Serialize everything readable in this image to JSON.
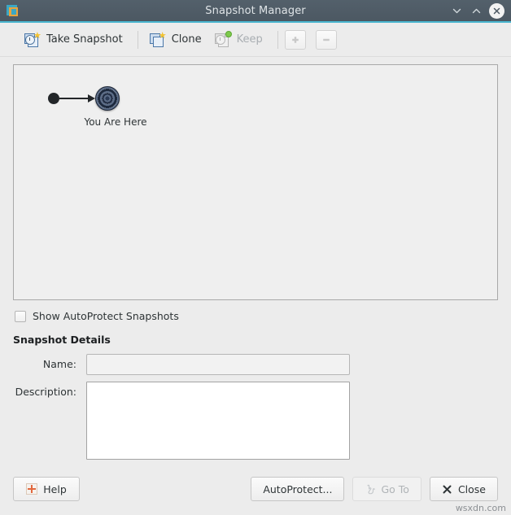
{
  "window": {
    "title": "Snapshot Manager",
    "app_icon": "vmware-logo-icon",
    "controls": {
      "minimize": "chevron-down-icon",
      "maximize": "chevron-up-icon",
      "close": "close-icon"
    }
  },
  "toolbar": {
    "take_snapshot": {
      "label": "Take Snapshot",
      "icon": "take-snapshot-icon",
      "enabled": true
    },
    "clone": {
      "label": "Clone",
      "icon": "clone-icon",
      "enabled": true
    },
    "keep": {
      "label": "Keep",
      "icon": "keep-icon",
      "enabled": false
    },
    "zoom_in": {
      "icon": "plus-icon",
      "enabled": false
    },
    "zoom_out": {
      "icon": "minus-icon",
      "enabled": false
    }
  },
  "canvas": {
    "node_caption": "You Are Here",
    "node_icon": "current-state-target-icon",
    "start_icon": "root-node-dot-icon",
    "arrow_icon": "arrow-right-icon"
  },
  "options": {
    "show_autoprotect": {
      "label": "Show AutoProtect Snapshots",
      "checked": false
    }
  },
  "details": {
    "section_title": "Snapshot Details",
    "name": {
      "label": "Name:",
      "value": "",
      "placeholder": ""
    },
    "description": {
      "label": "Description:",
      "value": "",
      "placeholder": ""
    }
  },
  "footer": {
    "help": {
      "label": "Help",
      "icon": "help-icon",
      "enabled": true
    },
    "autoprotect": {
      "label": "AutoProtect...",
      "enabled": true
    },
    "go_to": {
      "label": "Go To",
      "icon": "go-to-icon",
      "enabled": false
    },
    "close": {
      "label": "Close",
      "icon": "close-x-icon",
      "enabled": true
    }
  },
  "watermark": "wsxdn.com",
  "colors": {
    "titlebar": "#4c5862",
    "accent": "#49b5cf",
    "background": "#ececec",
    "canvas": "#efefef",
    "node": "#2b3a55"
  }
}
